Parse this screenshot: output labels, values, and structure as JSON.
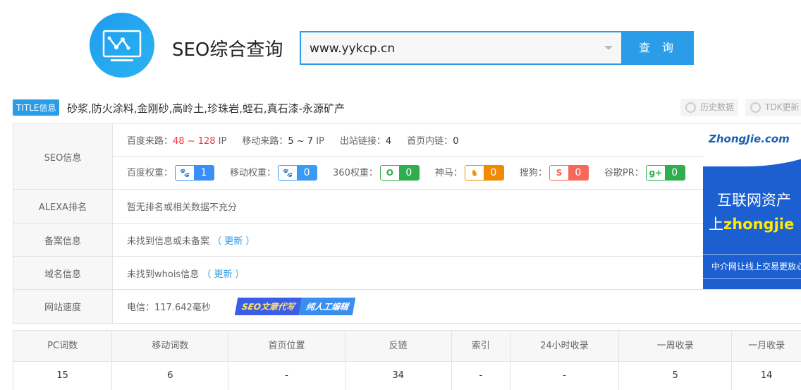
{
  "header": {
    "title": "SEO综合查询",
    "search_value": "www.yykcp.cn",
    "search_button": "查 询"
  },
  "title_info": {
    "badge": "TITLE信息",
    "text": "砂浆,防火涂料,金刚砂,高岭土,珍珠岩,蛭石,真石漆-永源矿产",
    "history": "历史数据",
    "tdk": "TDK更新"
  },
  "seo": {
    "label": "SEO信息",
    "baidu_traffic_label": "百度来路：",
    "baidu_traffic": "48 ~ 128",
    "ip1": " IP",
    "mobile_traffic_label": "移动来路：",
    "mobile_traffic": "5 ~ 7",
    "ip2": " IP",
    "outlinks_label": "出站链接：",
    "outlinks": "4",
    "inlinks_label": "首页内链：",
    "inlinks": "0",
    "weights": [
      {
        "label": "百度权重：",
        "value": "1",
        "color": "#3a8ef6",
        "icon": "paw-icon",
        "glyph": "🐾"
      },
      {
        "label": "移动权重：",
        "value": "0",
        "color": "#3a9af6",
        "icon": "paw-mobile-icon",
        "glyph": "🐾"
      },
      {
        "label": "360权重：",
        "value": "0",
        "color": "#2fae4f",
        "icon": "360-icon",
        "glyph": "O"
      },
      {
        "label": "神马：",
        "value": "0",
        "color": "#f08a00",
        "icon": "shenma-icon",
        "glyph": "♞"
      },
      {
        "label": "搜狗：",
        "value": "0",
        "color": "#f6685a",
        "icon": "sogou-icon",
        "glyph": "S"
      },
      {
        "label": "谷歌PR：",
        "value": "0",
        "color": "#2fae4f",
        "icon": "google-plus-icon",
        "glyph": "g+"
      }
    ]
  },
  "alexa": {
    "label": "ALEXA排名",
    "text": "暂无排名或相关数据不充分"
  },
  "beian": {
    "label": "备案信息",
    "text": "未找到信息或未备案",
    "link": "（ 更新 ）"
  },
  "domain": {
    "label": "域名信息",
    "text": "未找到whois信息",
    "link": "（ 更新 ）"
  },
  "speed": {
    "label": "网站速度",
    "text": "电信：117.642毫秒",
    "promo1": "SEO文章代写",
    "promo2": "纯人工编辑"
  },
  "ad": {
    "logo": "ZhongJie.com",
    "line1": "互联网资产",
    "line2a": "上",
    "line2b": "zhongjie",
    "line3": "中介网让线上交易更放心"
  },
  "stats": {
    "headers": [
      "PC词数",
      "移动词数",
      "首页位置",
      "反链",
      "索引",
      "24小时收录",
      "一周收录",
      "一月收录"
    ],
    "values": [
      "15",
      "6",
      "-",
      "34",
      "-",
      "-",
      "5",
      "14"
    ]
  }
}
